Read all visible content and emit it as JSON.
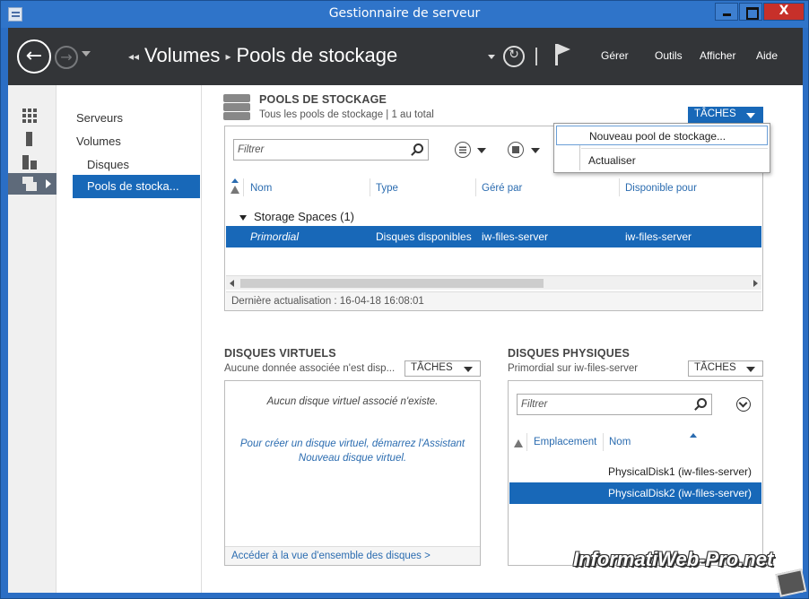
{
  "window": {
    "title": "Gestionnaire de serveur",
    "close_glyph": "X"
  },
  "header": {
    "breadcrumb": [
      "Volumes",
      "Pools de stockage"
    ],
    "menu": [
      "Gérer",
      "Outils",
      "Afficher",
      "Aide"
    ]
  },
  "subnav": {
    "items": [
      "Serveurs",
      "Volumes",
      "Disques",
      "Pools de stocka..."
    ]
  },
  "pools": {
    "title": "POOLS DE STOCKAGE",
    "subtitle": "Tous les pools de stockage | 1 au total",
    "tasks_label": "TÂCHES",
    "filter_placeholder": "Filtrer",
    "columns": [
      "Nom",
      "Type",
      "Géré par",
      "Disponible pour"
    ],
    "group": "Storage Spaces (1)",
    "rows": [
      {
        "name": "Primordial",
        "type": "Disques disponibles",
        "managed_by": "iw-files-server",
        "available_for": "iw-files-server"
      }
    ],
    "footer": "Dernière actualisation : 16-04-18 16:08:01"
  },
  "tasks_menu": {
    "items": [
      "Nouveau pool de stockage...",
      "Actualiser"
    ]
  },
  "virtual_disks": {
    "title": "DISQUES VIRTUELS",
    "subtitle": "Aucune donnée associée n'est disp...",
    "tasks_label": "TÂCHES",
    "empty_line": "Aucun disque virtuel associé n'existe.",
    "hint": "Pour créer un disque virtuel, démarrez l'Assistant Nouveau disque virtuel.",
    "link": "Accéder à la vue d'ensemble des disques >"
  },
  "physical_disks": {
    "title": "DISQUES PHYSIQUES",
    "subtitle": "Primordial sur iw-files-server",
    "tasks_label": "TÂCHES",
    "filter_placeholder": "Filtrer",
    "columns": [
      "Emplacement",
      "Nom"
    ],
    "rows": [
      "PhysicalDisk1 (iw-files-server)",
      "PhysicalDisk2 (iw-files-server)"
    ]
  },
  "watermark": "InformatiWeb-Pro.net",
  "colors": {
    "accent": "#1868b8",
    "header": "#333538",
    "titlebar": "#2f74c9"
  }
}
